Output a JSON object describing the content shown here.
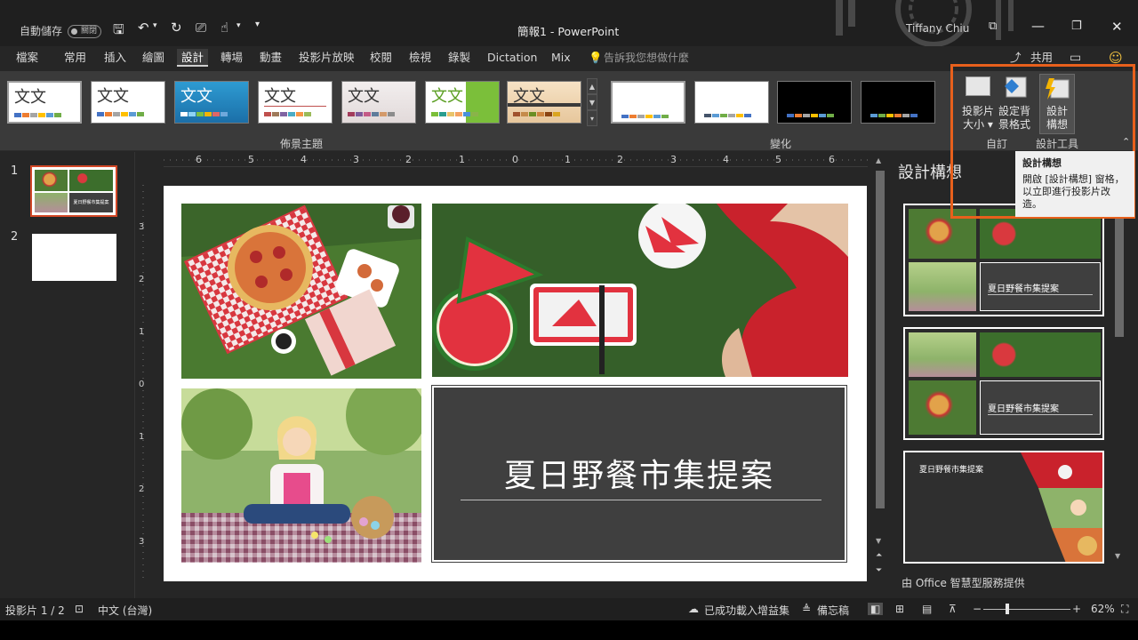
{
  "titlebar": {
    "autosave_label": "自動儲存",
    "autosave_state": "關閉",
    "file_title": "簡報1  -  PowerPoint",
    "user_name": "Tiffany Chiu"
  },
  "tabs": [
    "檔案",
    "常用",
    "插入",
    "繪圖",
    "設計",
    "轉場",
    "動畫",
    "投影片放映",
    "校閱",
    "檢視",
    "錄製",
    "Dictation",
    "Mix"
  ],
  "active_tab": "設計",
  "tell_me": "告訴我您想做什麼",
  "share_label": "共用",
  "ribbon": {
    "theme_text": "文文",
    "themes_group": "佈景主題",
    "variants_group": "變化",
    "slide_size_label_1": "投影片",
    "slide_size_label_2": "大小 ▾",
    "format_bg_label_1": "設定背",
    "format_bg_label_2": "景格式",
    "customize_group": "自訂",
    "designer_label_1": "設計",
    "designer_label_2": "構想",
    "designer_group": "設計工具"
  },
  "tooltip": {
    "title": "設計構想",
    "body": "開啟 [設計構想] 窗格，以立即進行投影片改造。"
  },
  "thumbnails": {
    "slide1_num": "1",
    "slide2_num": "2",
    "thumb_title": "夏日野餐市集提案"
  },
  "ruler": {
    "h_ticks": [
      "6",
      "5",
      "4",
      "3",
      "2",
      "1",
      "0",
      "1",
      "2",
      "3",
      "4",
      "5",
      "6"
    ],
    "v_ticks": [
      "3",
      "2",
      "1",
      "0",
      "1",
      "2",
      "3"
    ]
  },
  "slide": {
    "title": "夏日野餐市集提案"
  },
  "design_pane": {
    "title": "設計構想",
    "card_title": "夏日野餐市集提案",
    "footer": "由 Office 智慧型服務提供"
  },
  "status": {
    "slide_count": "投影片 1 / 2",
    "language": "中文 (台灣)",
    "addins": "已成功載入增益集",
    "notes": "備忘稿",
    "zoom": "62%"
  },
  "colors": {
    "accent_orange": "#e8601c",
    "title_box": "#3f3f3f",
    "window_bg": "#262626"
  }
}
